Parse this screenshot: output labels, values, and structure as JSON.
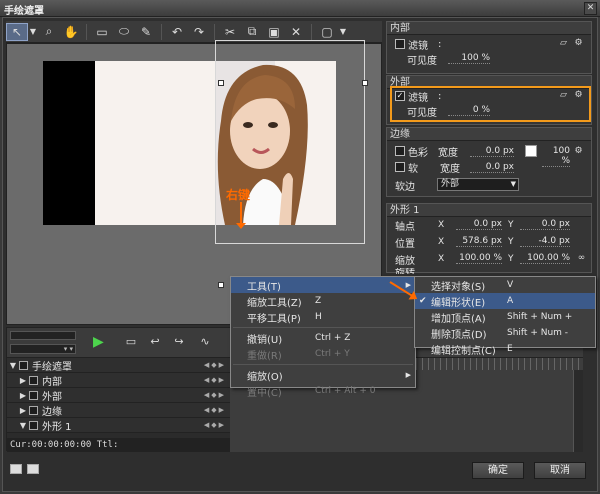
{
  "window": {
    "title": "手绘遮罩",
    "close": "✕"
  },
  "toolbar": {
    "icons": [
      "pointer-icon",
      "dropdown-arrow-icon",
      "zoom-icon",
      "hand-icon",
      "rectangle-icon",
      "ellipse-icon",
      "pen-icon",
      "undo-icon",
      "redo-icon",
      "cut-icon",
      "copy-icon",
      "paste-icon",
      "delete-icon",
      "view-icon"
    ]
  },
  "annotation": {
    "label": "右键"
  },
  "panels": {
    "inner": {
      "title": "内部",
      "filter_label": "滤镜",
      "colon": ":",
      "visibility_label": "可见度",
      "visibility_value": "100 %"
    },
    "outer": {
      "title": "外部",
      "filter_label": "滤镜",
      "colon": ":",
      "visibility_label": "可见度",
      "visibility_value": "0 %"
    },
    "edge": {
      "title": "边缘",
      "color_label": "色彩",
      "width_label": "宽度",
      "color_width": "0.0 px",
      "color_pct": "100 %",
      "soft_label": "软",
      "soft_width": "0.0 px",
      "soft_edge_label": "软边",
      "soft_edge_value": "外部"
    },
    "shape": {
      "title": "外形 1",
      "axis_label": "轴点",
      "axis_x": "0.0 px",
      "axis_y": "0.0 px",
      "pos_label": "位置",
      "pos_x": "578.6 px",
      "pos_y": "-4.0 px",
      "scale_label": "缩放",
      "scale_x": "100.00 %",
      "scale_y": "100.00 %",
      "rotate_label": "旋转",
      "x_label": "X",
      "y_label": "Y"
    }
  },
  "context_menu": {
    "items": [
      {
        "label": "工具(T)",
        "shortcut": "",
        "sub": "▶"
      },
      {
        "label": "缩放工具(Z)",
        "shortcut": "Z"
      },
      {
        "label": "平移工具(P)",
        "shortcut": "H"
      },
      {
        "label": "撤销(U)",
        "shortcut": "Ctrl + Z"
      },
      {
        "label": "重做(R)",
        "shortcut": "Ctrl + Y"
      },
      {
        "label": "缩放(O)",
        "sub": "▶"
      },
      {
        "label": "置中(C)",
        "shortcut": "Ctrl + Alt + 0"
      }
    ]
  },
  "submenu": {
    "items": [
      {
        "label": "选择对象(S)",
        "shortcut": "V"
      },
      {
        "label": "编辑形状(E)",
        "shortcut": "A",
        "check": "✔"
      },
      {
        "label": "增加顶点(A)",
        "shortcut": "Shift + Num +"
      },
      {
        "label": "删除顶点(D)",
        "shortcut": "Shift + Num -"
      },
      {
        "label": "编辑控制点(C)",
        "shortcut": "E"
      }
    ]
  },
  "tracks": [
    {
      "label": "手绘遮罩",
      "tri": "▼"
    },
    {
      "label": "内部",
      "tri": "▶"
    },
    {
      "label": "外部",
      "tri": "▶"
    },
    {
      "label": "边缘",
      "tri": "▶"
    },
    {
      "label": "外形 1",
      "tri": "▼"
    }
  ],
  "timeline": {
    "cur": "Cur:00:00:00:00",
    "ttl": "Ttl:"
  },
  "buttons": {
    "ok": "确定",
    "cancel": "取消"
  },
  "colors": {
    "highlight": "#f39a1b",
    "annotation": "#ff6a00",
    "menu_highlight": "#3c5a8a"
  }
}
